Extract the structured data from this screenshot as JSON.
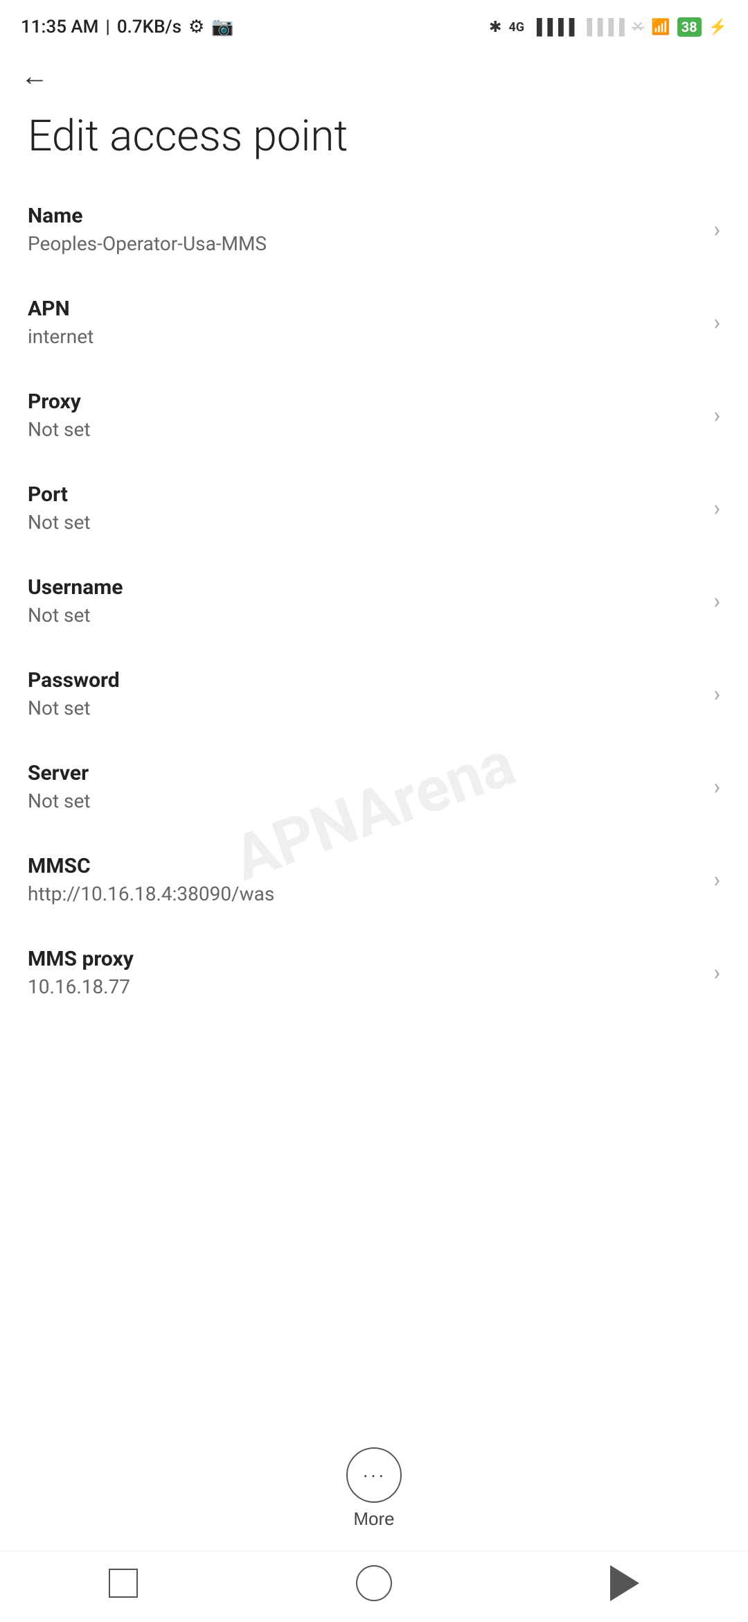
{
  "statusBar": {
    "time": "11:35 AM",
    "speed": "0.7KB/s",
    "battery": "38"
  },
  "header": {
    "backLabel": "←"
  },
  "page": {
    "title": "Edit access point"
  },
  "settings": {
    "items": [
      {
        "label": "Name",
        "value": "Peoples-Operator-Usa-MMS"
      },
      {
        "label": "APN",
        "value": "internet"
      },
      {
        "label": "Proxy",
        "value": "Not set"
      },
      {
        "label": "Port",
        "value": "Not set"
      },
      {
        "label": "Username",
        "value": "Not set"
      },
      {
        "label": "Password",
        "value": "Not set"
      },
      {
        "label": "Server",
        "value": "Not set"
      },
      {
        "label": "MMSC",
        "value": "http://10.16.18.4:38090/was"
      },
      {
        "label": "MMS proxy",
        "value": "10.16.18.77"
      }
    ]
  },
  "more": {
    "label": "More",
    "icon": "···"
  },
  "watermark": {
    "text": "APNArena"
  }
}
